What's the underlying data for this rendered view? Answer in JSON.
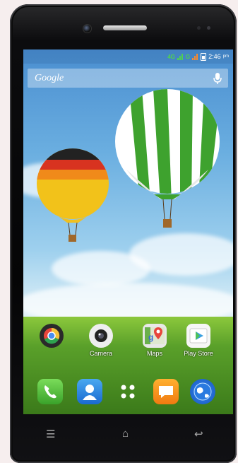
{
  "status": {
    "net1": "4G",
    "net2": "G",
    "time": "2:46",
    "ampm": "pm"
  },
  "search": {
    "brand": "Google"
  },
  "apps": [
    {
      "label": "",
      "icon": "chrome-folder-icon"
    },
    {
      "label": "Camera",
      "icon": "camera-icon"
    },
    {
      "label": "Maps",
      "icon": "maps-icon"
    },
    {
      "label": "Play Store",
      "icon": "play-store-icon"
    }
  ],
  "dock": [
    {
      "icon": "phone-icon"
    },
    {
      "icon": "contacts-icon"
    },
    {
      "icon": "app-drawer-icon"
    },
    {
      "icon": "messaging-icon"
    },
    {
      "icon": "browser-icon"
    }
  ],
  "nav": {
    "menu": "☰",
    "home": "⌂",
    "back": "↩"
  }
}
